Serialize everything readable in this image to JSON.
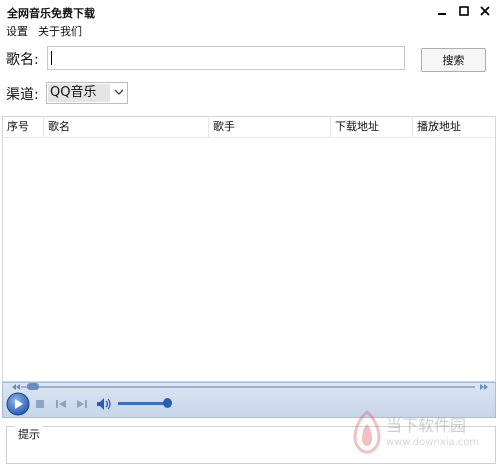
{
  "window": {
    "title": "全网音乐免费下载"
  },
  "menu": {
    "items": [
      "设置",
      "关于我们"
    ]
  },
  "search": {
    "label": "歌名:",
    "value": "",
    "button_label": "搜索"
  },
  "channel": {
    "label": "渠道:",
    "selected": "QQ音乐"
  },
  "table": {
    "columns": [
      "序号",
      "歌名",
      "歌手",
      "下载地址",
      "播放地址"
    ],
    "rows": []
  },
  "hint": {
    "label": "提示"
  },
  "watermark": {
    "text": "当下软件园",
    "url": "www.downxia.com"
  },
  "colors": {
    "accent": "#3a6fc4",
    "player_bg": "#d3dfef"
  }
}
